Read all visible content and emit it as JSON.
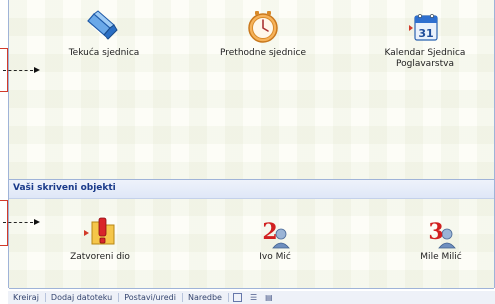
{
  "tiles_top": [
    {
      "name": "tekuca-sjednica",
      "label": "Tekuća sjednica",
      "icon": "books-icon"
    },
    {
      "name": "prethodne-sjednice",
      "label": "Prethodne sjednice",
      "icon": "clock-icon"
    },
    {
      "name": "kalendar-sjednica",
      "label_line1": "Kalendar Sjednica",
      "label_line2": "Poglavarstva",
      "icon": "calendar-icon",
      "calendar_day": "31"
    }
  ],
  "section": {
    "title": "Vaši skriveni objekti"
  },
  "tiles_bottom": [
    {
      "name": "zatvoreni-dio",
      "label": "Zatvoreni dio",
      "icon": "exclamation-folder-icon"
    },
    {
      "name": "ivo-mic",
      "label": "Ivo Mić",
      "icon": "user-number-2-icon",
      "badge": "2"
    },
    {
      "name": "mile-milic",
      "label": "Mile Milić",
      "icon": "user-number-3-icon",
      "badge": "3"
    }
  ],
  "statusbar": {
    "items": [
      "Kreiraj",
      "Dodaj datoteku",
      "Postavi/uredi",
      "Naredbe"
    ],
    "icons": [
      "square-icon",
      "list-icon",
      "details-icon"
    ]
  },
  "colors": {
    "accent": "#1a3a8a",
    "callout": "#d23a2a",
    "band": "#dfe7f7"
  }
}
